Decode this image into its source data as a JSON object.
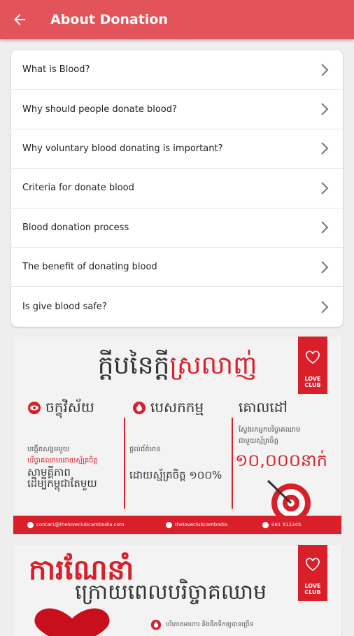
{
  "appbar": {
    "title": "About Donation",
    "back_icon": "arrow-left-icon"
  },
  "menu": {
    "items": [
      {
        "label": "What is Blood?"
      },
      {
        "label": "Why should people donate blood?"
      },
      {
        "label": "Why voluntary blood donating is important?"
      },
      {
        "label": "Criteria for donate blood"
      },
      {
        "label": "Blood donation process"
      },
      {
        "label": "The benefit of donating blood"
      },
      {
        "label": "Is give blood safe?"
      }
    ]
  },
  "banner1": {
    "title_black": "ក្ដីបនៃក្ដី",
    "title_red": "ស្រលាញ់",
    "col1_head": "ចក្ខុវិស័យ",
    "col2_head": "បេសកកម្ម",
    "col3_head": "គោលដៅ",
    "col1_lines": [
      "បង្កើតសង្គមមួយ",
      "បរិច្ចាគឈាមដោយស្ម័គ្រចិត្ត",
      "សាមគ្គីភាព",
      "ដើម្បីកម្ពុជាតែមួយ"
    ],
    "col2_lines": [
      "ផ្ដល់ព័ត៌មាន",
      "ដោយស្ម័គ្រចិត្ត ១០០%"
    ],
    "col3_lines": [
      "ស្វែងរកអ្នកបរិច្ចាគឈាម",
      "ជាមួយស្ម័គ្រចិត្ត"
    ],
    "target_number": "១០,០០០នាក់",
    "logo_text": [
      "LOVE",
      "CLUB"
    ],
    "footer_email": "contact@theloveclubcambodia.com",
    "footer_facebook": "theloveclubcambodia",
    "footer_phone": "061 512245"
  },
  "banner2": {
    "title": "ការណែនាំ",
    "subtitle": "ក្រោយពេលបរិច្ចាគឈាម",
    "logo_text": [
      "LOVE",
      "CLUB"
    ],
    "lines": [
      "បរិភោគអាហារ និងផឹកទឹកឲ្យបានច្រើន"
    ]
  },
  "colors": {
    "primary": "#e2545a",
    "accent": "#d91f2a"
  }
}
